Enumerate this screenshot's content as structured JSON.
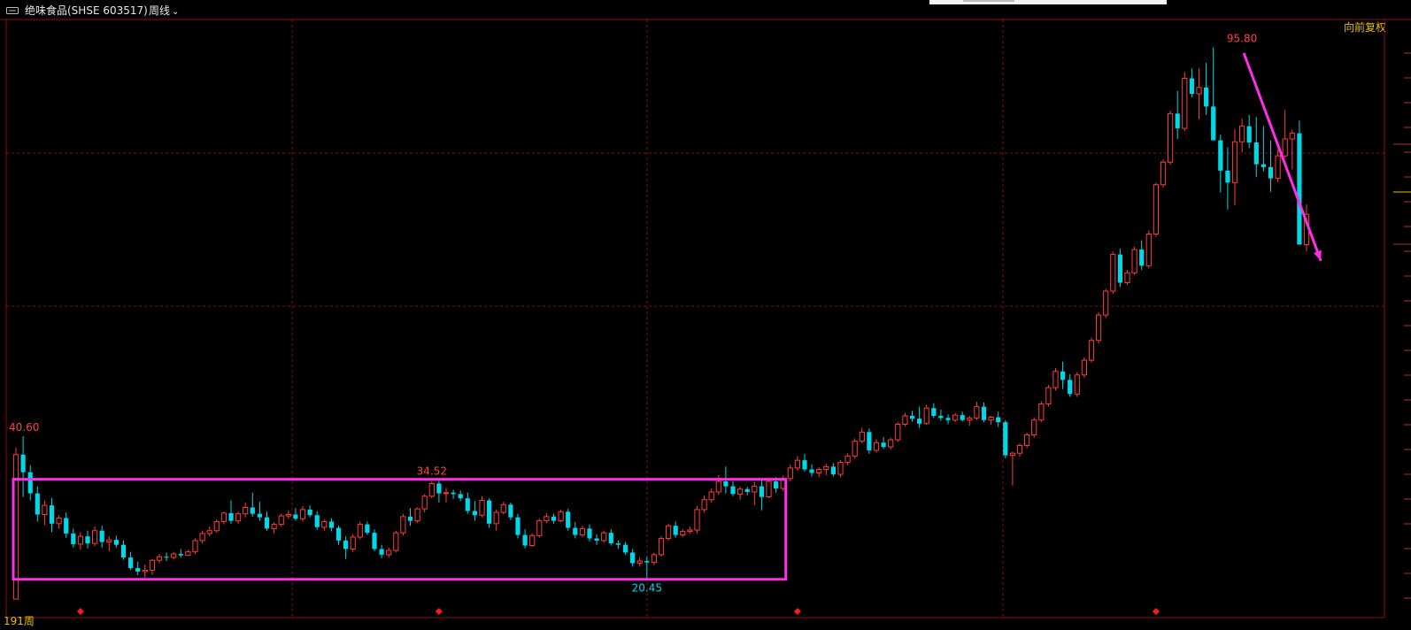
{
  "header": {
    "title": "绝味食品(SHSE 603517)",
    "period": "周线",
    "adjust": "向前复权",
    "icon": "chart-link-icon"
  },
  "footer": {
    "bar_count_label": "191周"
  },
  "colors": {
    "up": "#ff3c3c",
    "down": "#00d8e8",
    "grid": "#8a1010",
    "box": "#ff2ee6",
    "arrow": "#ff2ee6",
    "marker": "#ff1818",
    "label_high": "#ff4040",
    "label_low": "#00d8e8",
    "accent": "#e8c000"
  },
  "chart_data": {
    "type": "candlestick",
    "title": "绝味食品(SHSE 603517)",
    "period": "weekly",
    "adjustment": "forward-adjusted",
    "y_range": [
      16.5,
      99.5
    ],
    "bar_count": 185,
    "labels": [
      {
        "id": "high-label",
        "text": "95.80",
        "bar": 171,
        "price": 95.8,
        "kind": "high"
      },
      {
        "id": "early-high-label",
        "text": "40.60",
        "bar": 1,
        "price": 40.6,
        "kind": "high"
      },
      {
        "id": "mid-high-label",
        "text": "34.52",
        "bar": 58,
        "price": 34.52,
        "kind": "high"
      },
      {
        "id": "low-label",
        "text": "20.45",
        "bar": 88,
        "price": 20.45,
        "kind": "low"
      }
    ],
    "annotations": {
      "box": {
        "from_bar": 0,
        "to_bar": 107,
        "price_low": 20.3,
        "price_high": 34.5
      },
      "arrow": {
        "from_bar": 171,
        "from_price": 95.0,
        "to_bar": 182,
        "to_price": 65.5
      }
    },
    "markers_at_bars": [
      9,
      59,
      109,
      159
    ],
    "ohlc": [
      [
        17.5,
        39,
        17.5,
        38
      ],
      [
        38,
        40.6,
        32,
        35.5
      ],
      [
        35.5,
        36.5,
        31.5,
        32.5
      ],
      [
        32.5,
        33.5,
        28.5,
        29.5
      ],
      [
        29.5,
        31.5,
        28,
        30.8
      ],
      [
        30.8,
        31.8,
        27,
        28.2
      ],
      [
        28.2,
        29.4,
        27.5,
        29
      ],
      [
        29,
        29.8,
        26.2,
        26.8
      ],
      [
        26.8,
        27.5,
        24.8,
        25.3
      ],
      [
        25.3,
        27,
        24.5,
        26.4
      ],
      [
        26.4,
        27.2,
        24.7,
        25.4
      ],
      [
        25.4,
        27.8,
        25,
        27.2
      ],
      [
        27.2,
        27.9,
        24.8,
        25.6
      ],
      [
        25.6,
        26.4,
        24.3,
        25.9
      ],
      [
        25.9,
        26.5,
        24.8,
        25.2
      ],
      [
        25.2,
        25.8,
        23.1,
        23.4
      ],
      [
        23.4,
        24.2,
        21.6,
        21.9
      ],
      [
        21.9,
        22.8,
        20.9,
        21.4
      ],
      [
        21.4,
        22.4,
        20.5,
        21.6
      ],
      [
        21.6,
        23.2,
        20.9,
        23
      ],
      [
        23,
        23.9,
        22.6,
        23.5
      ],
      [
        23.5,
        24.1,
        22.9,
        23.4
      ],
      [
        23.4,
        24.2,
        23.1,
        23.9
      ],
      [
        23.9,
        24.6,
        23.4,
        23.7
      ],
      [
        23.7,
        24.5,
        23.6,
        24.2
      ],
      [
        24.2,
        26.1,
        23.9,
        25.8
      ],
      [
        25.8,
        27.2,
        25.4,
        26.8
      ],
      [
        26.8,
        27.8,
        26.4,
        27.2
      ],
      [
        27.2,
        28.8,
        26.9,
        28.5
      ],
      [
        28.5,
        29.9,
        28.1,
        29.7
      ],
      [
        29.7,
        31.5,
        28.2,
        28.6
      ],
      [
        28.6,
        29.9,
        28.2,
        29.6
      ],
      [
        29.6,
        31.2,
        29.1,
        30.5
      ],
      [
        30.5,
        32.6,
        29.2,
        29.6
      ],
      [
        29.6,
        31.3,
        28.6,
        29.1
      ],
      [
        29.1,
        29.9,
        27.2,
        27.5
      ],
      [
        27.5,
        28.4,
        26.8,
        28.1
      ],
      [
        28.1,
        29.6,
        27.8,
        29.3
      ],
      [
        29.3,
        30.1,
        28.9,
        29.5
      ],
      [
        29.5,
        30.4,
        28.6,
        28.9
      ],
      [
        28.9,
        30.7,
        28.5,
        30.2
      ],
      [
        30.2,
        30.8,
        29.1,
        29.4
      ],
      [
        29.4,
        30,
        27.3,
        27.7
      ],
      [
        27.7,
        28.8,
        27.2,
        28.5
      ],
      [
        28.5,
        29,
        27.1,
        27.6
      ],
      [
        27.6,
        27.9,
        25.2,
        25.8
      ],
      [
        25.8,
        26.4,
        23.2,
        24.6
      ],
      [
        24.6,
        26.7,
        24.2,
        26.3
      ],
      [
        26.3,
        28.5,
        26,
        28.1
      ],
      [
        28.1,
        28.5,
        26.6,
        26.9
      ],
      [
        26.9,
        27.4,
        24.3,
        24.6
      ],
      [
        24.6,
        25.2,
        23.3,
        23.8
      ],
      [
        23.8,
        24.8,
        23.4,
        24.4
      ],
      [
        24.4,
        27.2,
        24.1,
        26.9
      ],
      [
        26.9,
        29.6,
        26.5,
        29.2
      ],
      [
        29.2,
        30.4,
        27.9,
        28.6
      ],
      [
        28.6,
        30.5,
        28.3,
        30.3
      ],
      [
        30.3,
        32.4,
        29.8,
        32.1
      ],
      [
        32.1,
        34.2,
        31.8,
        33.9
      ],
      [
        33.9,
        34.52,
        31.2,
        32.5
      ],
      [
        32.5,
        33.3,
        31.2,
        32.6
      ],
      [
        32.6,
        33,
        31.7,
        32.4
      ],
      [
        32.4,
        32.9,
        31.4,
        31.8
      ],
      [
        31.8,
        32.6,
        29.6,
        30
      ],
      [
        30,
        31.4,
        28.6,
        29.4
      ],
      [
        29.4,
        32.1,
        29.1,
        31.5
      ],
      [
        31.5,
        31.8,
        27.6,
        28.2
      ],
      [
        28.2,
        30.2,
        27.2,
        29.8
      ],
      [
        29.8,
        31.3,
        29.5,
        30.9
      ],
      [
        30.9,
        31.2,
        28.7,
        29.1
      ],
      [
        29.1,
        29.6,
        26.1,
        26.6
      ],
      [
        26.6,
        27.4,
        24.7,
        25.1
      ],
      [
        25.1,
        26.8,
        24.9,
        26.5
      ],
      [
        26.5,
        28.9,
        26.2,
        28.6
      ],
      [
        28.6,
        29.7,
        28.3,
        29.2
      ],
      [
        29.2,
        29.6,
        28.2,
        28.6
      ],
      [
        28.6,
        30.2,
        28.4,
        29.9
      ],
      [
        29.9,
        30.3,
        27.2,
        27.6
      ],
      [
        27.6,
        28.4,
        26.1,
        26.6
      ],
      [
        26.6,
        27.9,
        26.3,
        27.5
      ],
      [
        27.5,
        28.1,
        25.7,
        26.1
      ],
      [
        26.1,
        26.7,
        25.2,
        25.8
      ],
      [
        25.8,
        27.2,
        25.5,
        26.9
      ],
      [
        26.9,
        27.4,
        25.1,
        25.4
      ],
      [
        25.4,
        25.8,
        24.6,
        25.2
      ],
      [
        25.2,
        25.6,
        23.8,
        24.1
      ],
      [
        24.1,
        24.6,
        22.1,
        22.6
      ],
      [
        22.6,
        23.4,
        22.1,
        22.9
      ],
      [
        22.9,
        23.5,
        20.45,
        22.7
      ],
      [
        22.7,
        24.1,
        22.3,
        23.8
      ],
      [
        23.8,
        26.4,
        23.5,
        26.1
      ],
      [
        26.1,
        28.2,
        25.8,
        27.9
      ],
      [
        27.9,
        28.5,
        26.2,
        26.6
      ],
      [
        26.6,
        27.4,
        26.3,
        27.1
      ],
      [
        27.1,
        27.8,
        26.8,
        27.3
      ],
      [
        27.3,
        30.7,
        26.8,
        30.2
      ],
      [
        30.2,
        32.2,
        29.8,
        31.6
      ],
      [
        31.6,
        33.2,
        31.2,
        32.7
      ],
      [
        32.7,
        35.1,
        32.3,
        34.2
      ],
      [
        34.2,
        36.3,
        32.5,
        33.5
      ],
      [
        33.5,
        34.2,
        32.1,
        32.4
      ],
      [
        32.4,
        33.5,
        31.6,
        33.1
      ],
      [
        33.1,
        33.4,
        32.2,
        32.7
      ],
      [
        32.7,
        34.1,
        30.8,
        33.5
      ],
      [
        33.5,
        34.4,
        30.1,
        32
      ],
      [
        32,
        34.6,
        31.8,
        34.2
      ],
      [
        34.2,
        34.8,
        32.6,
        33.2
      ],
      [
        33.2,
        35,
        32.8,
        34.6
      ],
      [
        34.6,
        36.6,
        34.2,
        36.1
      ],
      [
        36.1,
        37.8,
        35.7,
        37.2
      ],
      [
        37.2,
        38.1,
        35.6,
        35.9
      ],
      [
        35.9,
        36.6,
        34.9,
        35.4
      ],
      [
        35.4,
        36.2,
        34.8,
        35.9
      ],
      [
        35.9,
        36.7,
        35.1,
        36.3
      ],
      [
        36.3,
        36.8,
        34.9,
        35.2
      ],
      [
        35.2,
        37.2,
        34.8,
        36.9
      ],
      [
        36.9,
        38.2,
        36.5,
        37.8
      ],
      [
        37.8,
        40.3,
        37.4,
        39.9
      ],
      [
        39.9,
        41.8,
        39.6,
        41.2
      ],
      [
        41.2,
        41.7,
        38.1,
        38.6
      ],
      [
        38.6,
        40.2,
        38.3,
        39.7
      ],
      [
        39.7,
        40.5,
        38.8,
        39.1
      ],
      [
        39.1,
        40.4,
        38.7,
        40.1
      ],
      [
        40.1,
        42.6,
        39.8,
        42.3
      ],
      [
        42.3,
        43.9,
        42,
        43.5
      ],
      [
        43.5,
        44.2,
        42.7,
        43.1
      ],
      [
        43.1,
        44.8,
        41.8,
        42.4
      ],
      [
        42.4,
        45.1,
        42.2,
        44.6
      ],
      [
        44.6,
        45.3,
        43.2,
        43.5
      ],
      [
        43.5,
        44.4,
        42.8,
        43.2
      ],
      [
        43.2,
        43.7,
        42.3,
        42.9
      ],
      [
        42.9,
        43.9,
        42.6,
        43.6
      ],
      [
        43.6,
        44.1,
        42.7,
        42.9
      ],
      [
        42.9,
        43.5,
        42.1,
        43.2
      ],
      [
        43.2,
        45.5,
        42.9,
        44.8
      ],
      [
        44.8,
        45.4,
        42.6,
        42.9
      ],
      [
        42.9,
        43.5,
        42.2,
        43.3
      ],
      [
        43.3,
        44.1,
        41.9,
        42.6
      ],
      [
        42.6,
        42.9,
        37.5,
        37.9
      ],
      [
        37.9,
        38.4,
        33.6,
        38.2
      ],
      [
        38.2,
        39.6,
        37.7,
        39.3
      ],
      [
        39.3,
        41.1,
        38.9,
        40.8
      ],
      [
        40.8,
        43.3,
        40.4,
        42.9
      ],
      [
        42.9,
        45.6,
        42.6,
        45.2
      ],
      [
        45.2,
        47.9,
        44.8,
        47.5
      ],
      [
        47.5,
        50.3,
        47.1,
        49.8
      ],
      [
        49.8,
        51.2,
        47.3,
        48.6
      ],
      [
        48.6,
        49.4,
        46.2,
        46.6
      ],
      [
        46.6,
        49.7,
        46.2,
        49.3
      ],
      [
        49.3,
        51.8,
        48.9,
        51.4
      ],
      [
        51.4,
        54.6,
        51.1,
        54.2
      ],
      [
        54.2,
        58.2,
        53.8,
        57.8
      ],
      [
        57.8,
        61.5,
        57.4,
        61.2
      ],
      [
        61.2,
        66.8,
        60.8,
        66.4
      ],
      [
        66.4,
        67.2,
        61.8,
        62.4
      ],
      [
        62.4,
        64.2,
        62.1,
        63.8
      ],
      [
        63.8,
        67.5,
        63.5,
        67.1
      ],
      [
        67.1,
        68.4,
        64.2,
        64.8
      ],
      [
        64.8,
        69.8,
        64.4,
        69.3
      ],
      [
        69.3,
        76.6,
        68.9,
        76.3
      ],
      [
        76.3,
        79.9,
        75.9,
        79.5
      ],
      [
        79.5,
        86.8,
        79.1,
        86.4
      ],
      [
        86.4,
        89.6,
        82.8,
        84.3
      ],
      [
        84.3,
        92.3,
        83.9,
        91.4
      ],
      [
        91.4,
        92.8,
        88.7,
        89.2
      ],
      [
        89.2,
        92.8,
        85.6,
        90.1
      ],
      [
        90.1,
        93.6,
        86.2,
        87.4
      ],
      [
        87.4,
        95.8,
        86.1,
        82.6
      ],
      [
        82.6,
        83.4,
        75.2,
        78.3
      ],
      [
        78.3,
        81.6,
        72.8,
        76.6
      ],
      [
        76.6,
        84.2,
        73.4,
        82.4
      ],
      [
        82.4,
        85.7,
        80.9,
        84.6
      ],
      [
        84.6,
        86.2,
        81.5,
        82.3
      ],
      [
        82.3,
        85.9,
        77.4,
        79.2
      ],
      [
        79.2,
        84.6,
        78.2,
        78.8
      ],
      [
        78.8,
        82.6,
        75.3,
        77.2
      ],
      [
        77.2,
        81.3,
        76.7,
        80.4
      ],
      [
        80.4,
        86.9,
        80.1,
        82.8
      ],
      [
        82.8,
        84.1,
        78.5,
        83.6
      ],
      [
        83.6,
        85.4,
        74.2,
        67.8
      ],
      [
        67.8,
        73.5,
        66.8,
        72.1
      ]
    ]
  }
}
